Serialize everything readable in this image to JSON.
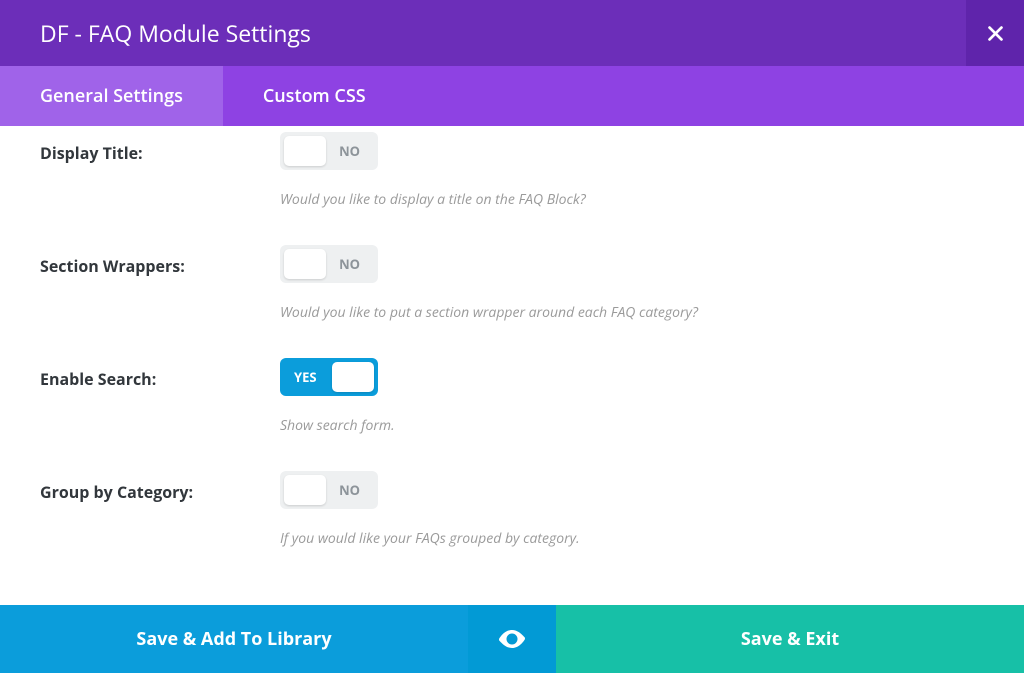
{
  "header": {
    "title": "DF - FAQ Module Settings"
  },
  "tabs": {
    "general": "General Settings",
    "custom_css": "Custom CSS",
    "active": "general"
  },
  "toggle_labels": {
    "on": "YES",
    "off": "NO"
  },
  "settings": [
    {
      "key": "display_title",
      "label": "Display Title:",
      "value": false,
      "hint": "Would you like to display a title on the FAQ Block?"
    },
    {
      "key": "section_wrappers",
      "label": "Section Wrappers:",
      "value": false,
      "hint": "Would you like to put a section wrapper around each FAQ category?"
    },
    {
      "key": "enable_search",
      "label": "Enable Search:",
      "value": true,
      "hint": "Show search form."
    },
    {
      "key": "group_by_cat",
      "label": "Group by Category:",
      "value": false,
      "hint": "If you would like your FAQs grouped by category."
    }
  ],
  "footer": {
    "save_add_library": "Save & Add To Library",
    "save_exit": "Save & Exit"
  },
  "colors": {
    "header_bg": "#6c2eb9",
    "close_bg": "#5f24ab",
    "tabs_bg": "#8e42e3",
    "tab_active_bg": "#a063e9",
    "accent_blue": "#0b9ddb",
    "accent_teal": "#17c0a7"
  }
}
